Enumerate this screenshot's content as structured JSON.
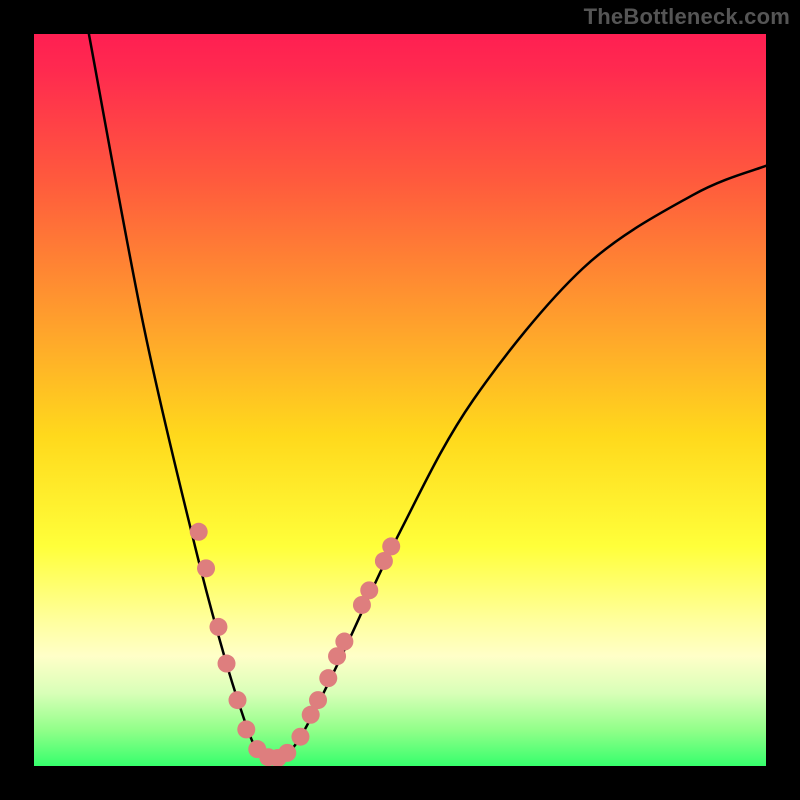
{
  "watermark": "TheBottleneck.com",
  "chart_data": {
    "type": "line",
    "title": "",
    "xlabel": "",
    "ylabel": "",
    "xlim": [
      0,
      100
    ],
    "ylim": [
      0,
      100
    ],
    "grid": false,
    "gradient": {
      "stops": [
        {
          "offset": 0.0,
          "color": "#FF1F52"
        },
        {
          "offset": 0.05,
          "color": "#FF2A4F"
        },
        {
          "offset": 0.2,
          "color": "#FF5A3D"
        },
        {
          "offset": 0.4,
          "color": "#FFA22C"
        },
        {
          "offset": 0.55,
          "color": "#FFD91C"
        },
        {
          "offset": 0.7,
          "color": "#FFFF3A"
        },
        {
          "offset": 0.8,
          "color": "#FFFF9C"
        },
        {
          "offset": 0.85,
          "color": "#FFFFC8"
        },
        {
          "offset": 0.9,
          "color": "#D9FFB8"
        },
        {
          "offset": 0.95,
          "color": "#93FF8A"
        },
        {
          "offset": 1.0,
          "color": "#36FF6C"
        }
      ]
    },
    "series": [
      {
        "name": "curve",
        "type": "smooth",
        "color": "#000000",
        "width": 2.5,
        "points": [
          {
            "x": 7.5,
            "y": 100
          },
          {
            "x": 15,
            "y": 60
          },
          {
            "x": 22,
            "y": 30
          },
          {
            "x": 26,
            "y": 15
          },
          {
            "x": 28.5,
            "y": 7
          },
          {
            "x": 30,
            "y": 3
          },
          {
            "x": 31.5,
            "y": 1
          },
          {
            "x": 33,
            "y": 0.8
          },
          {
            "x": 34.5,
            "y": 1.5
          },
          {
            "x": 37,
            "y": 5
          },
          {
            "x": 42,
            "y": 15
          },
          {
            "x": 50,
            "y": 32
          },
          {
            "x": 60,
            "y": 50
          },
          {
            "x": 75,
            "y": 68
          },
          {
            "x": 90,
            "y": 78
          },
          {
            "x": 100,
            "y": 82
          }
        ]
      },
      {
        "name": "markers-left",
        "type": "markers",
        "color": "#DE7E7E",
        "radius": 9,
        "points": [
          {
            "x": 22.5,
            "y": 32
          },
          {
            "x": 23.5,
            "y": 27
          },
          {
            "x": 25.2,
            "y": 19
          },
          {
            "x": 26.3,
            "y": 14
          },
          {
            "x": 27.8,
            "y": 9
          },
          {
            "x": 29.0,
            "y": 5
          },
          {
            "x": 30.5,
            "y": 2.3
          },
          {
            "x": 32.0,
            "y": 1.2
          },
          {
            "x": 33.3,
            "y": 1.1
          },
          {
            "x": 34.6,
            "y": 1.8
          }
        ]
      },
      {
        "name": "markers-right",
        "type": "markers",
        "color": "#DE7E7E",
        "radius": 9,
        "points": [
          {
            "x": 36.4,
            "y": 4
          },
          {
            "x": 37.8,
            "y": 7
          },
          {
            "x": 38.8,
            "y": 9
          },
          {
            "x": 40.2,
            "y": 12
          },
          {
            "x": 41.4,
            "y": 15
          },
          {
            "x": 42.4,
            "y": 17
          },
          {
            "x": 44.8,
            "y": 22
          },
          {
            "x": 45.8,
            "y": 24
          },
          {
            "x": 47.8,
            "y": 28
          },
          {
            "x": 48.8,
            "y": 30
          }
        ]
      }
    ]
  }
}
